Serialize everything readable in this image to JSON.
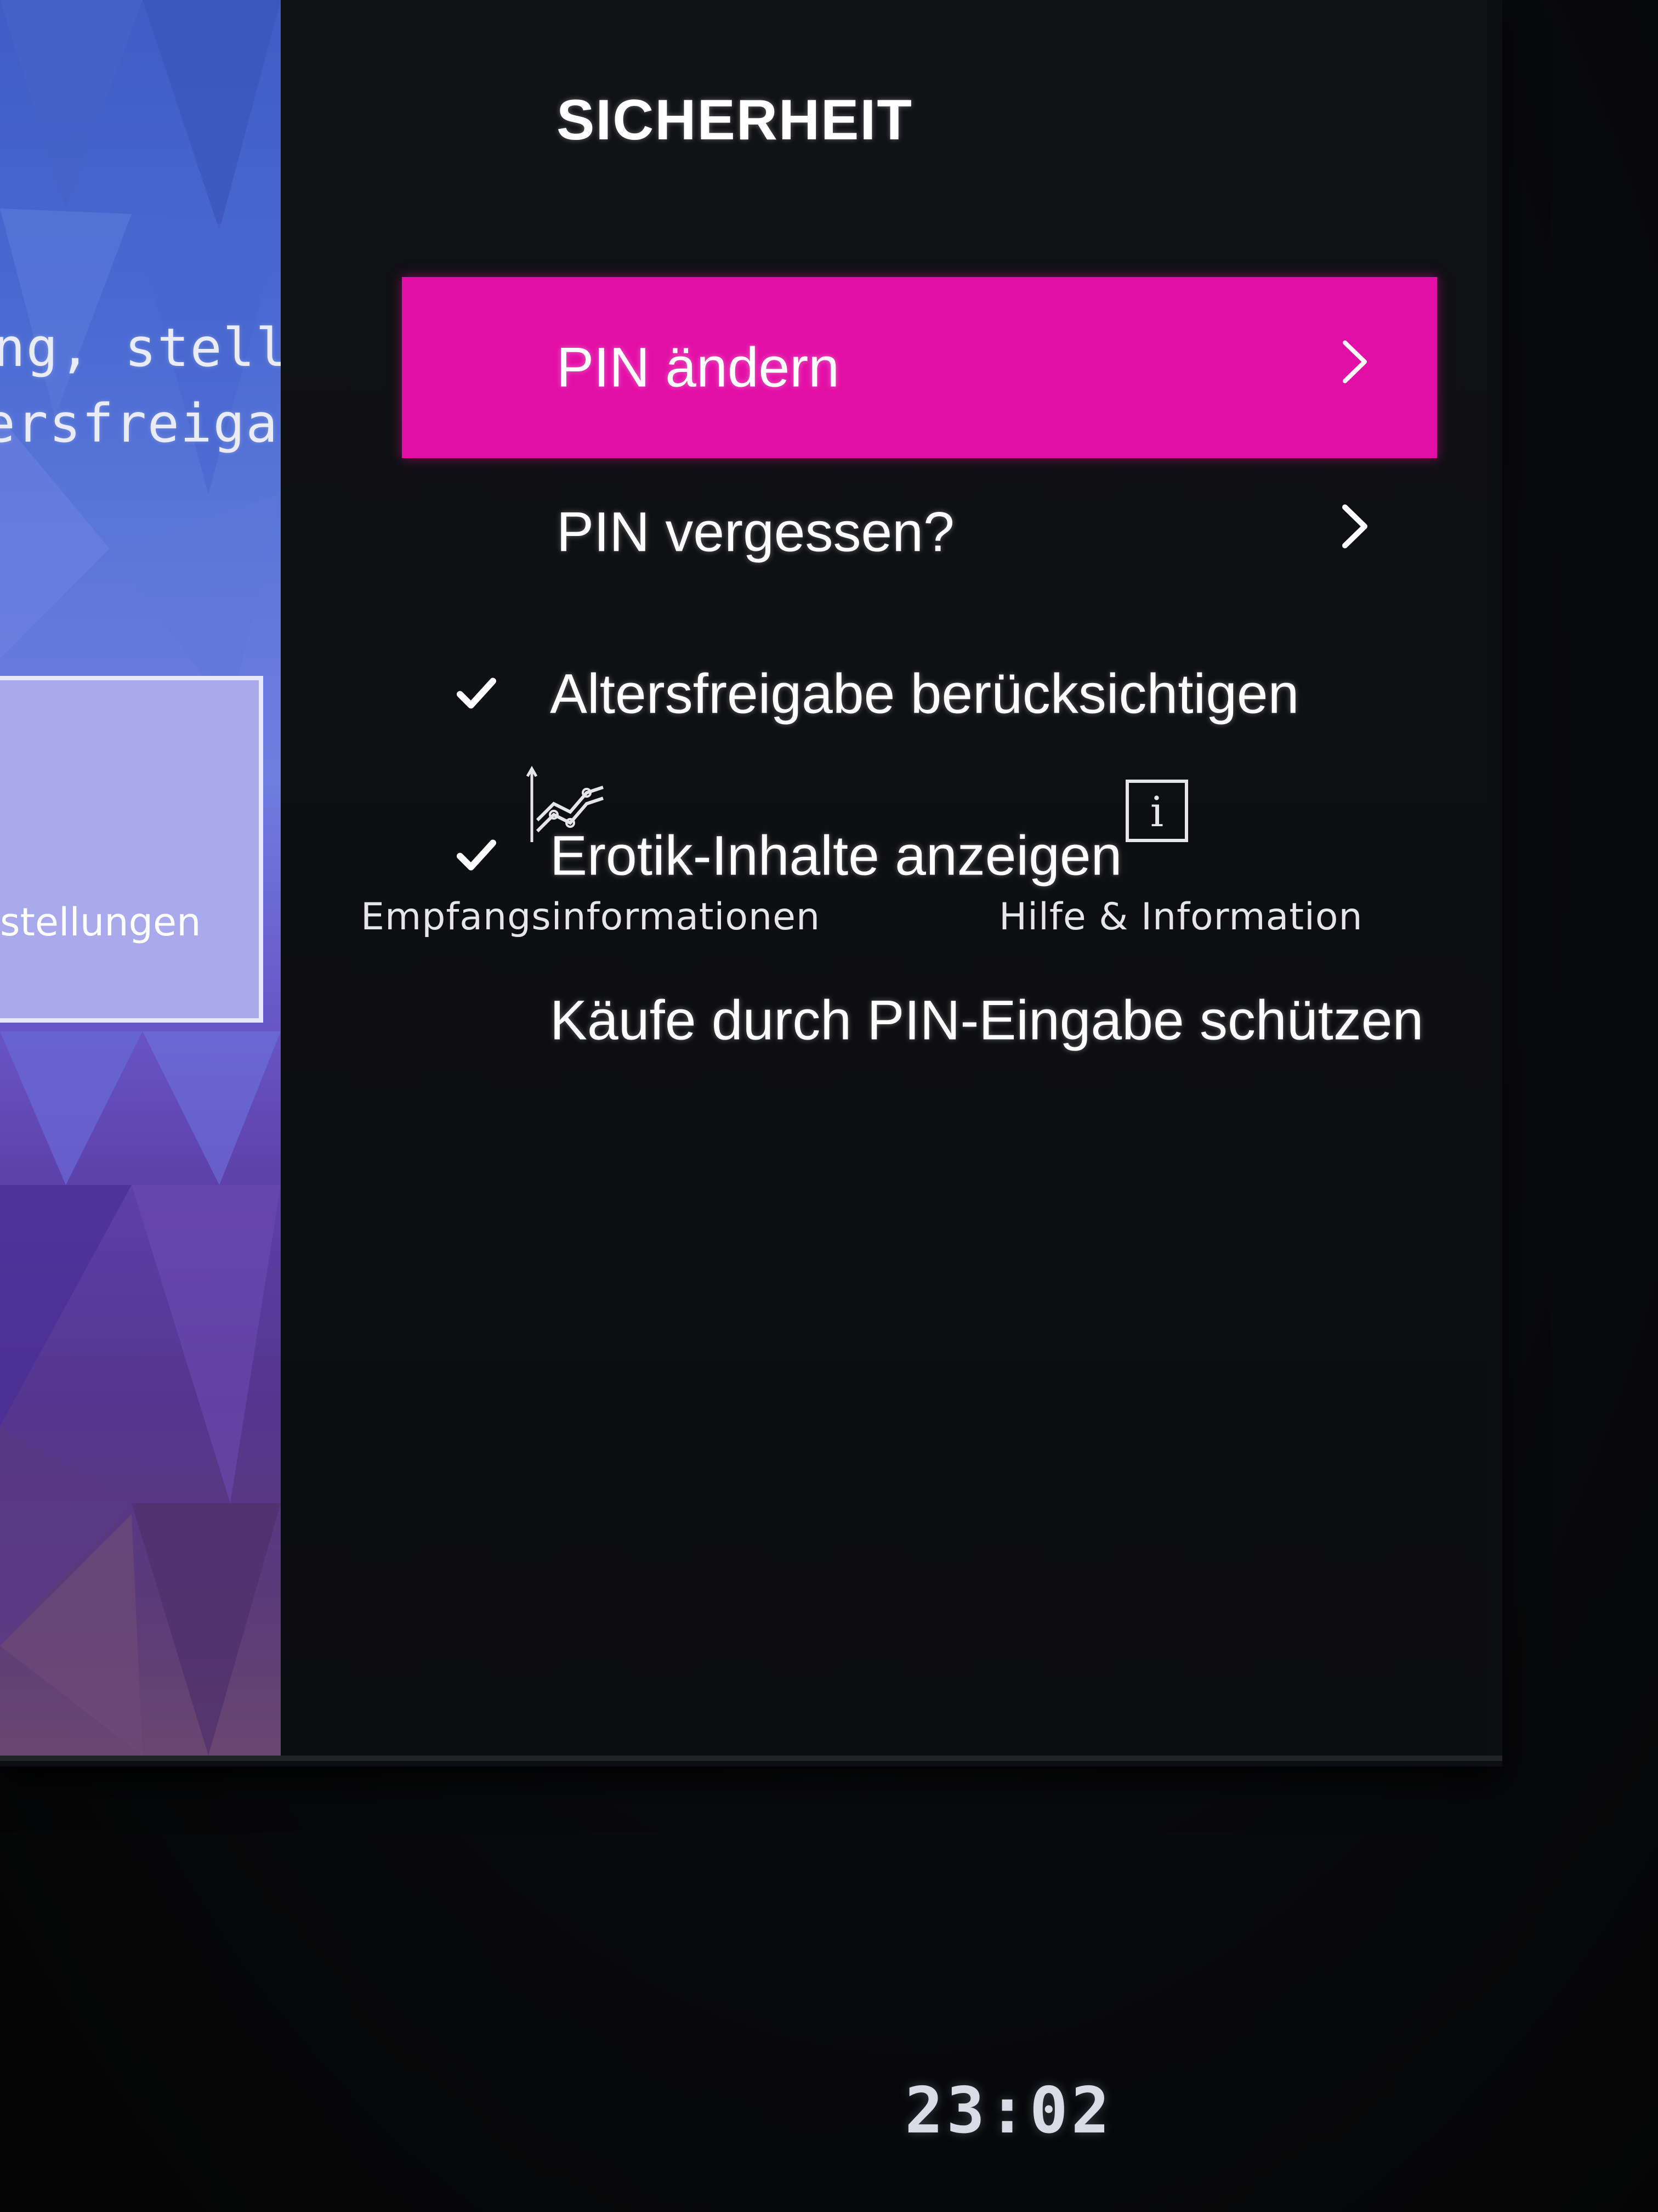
{
  "background": {
    "line1": "ng, stellst",
    "line2": "ersfreigabe bzw.",
    "tile_label": "stellungen"
  },
  "menu": {
    "title": "SICHERHEIT",
    "accent_color": "#e20fa6",
    "items": [
      {
        "label": "PIN ändern",
        "selected": true,
        "chevron": true,
        "checked": false
      },
      {
        "label": "PIN vergessen?",
        "selected": false,
        "chevron": true,
        "checked": false
      },
      {
        "label": "Altersfreigabe berücksichtigen",
        "selected": false,
        "chevron": false,
        "checked": true
      },
      {
        "label": "Erotik-Inhalte anzeigen",
        "selected": false,
        "chevron": false,
        "checked": true
      },
      {
        "label": "Käufe durch PIN-Eingabe schützen",
        "selected": false,
        "chevron": false,
        "checked": false
      }
    ]
  },
  "overlay": {
    "reception_label": "Empfangsinformationen",
    "help_label": "Hilfe & Information",
    "help_icon_glyph": "i"
  },
  "clock": {
    "time": "23:02"
  }
}
